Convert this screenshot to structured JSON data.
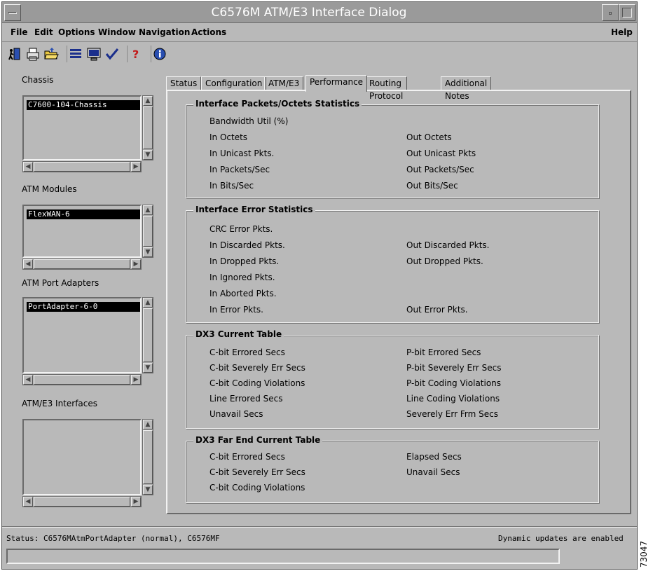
{
  "window": {
    "title": "C6576M ATM/E3 Interface Dialog"
  },
  "menubar": {
    "file": "File",
    "edit": "Edit",
    "options": "Options",
    "window": "Window",
    "navigation": "Navigation",
    "actions": "Actions",
    "help": "Help"
  },
  "toolbar": {
    "icons": [
      "exit-door-icon",
      "printer-icon",
      "open-folder-icon",
      "list-icon",
      "monitor-icon",
      "checkmark-icon",
      "help-question-icon",
      "info-icon"
    ]
  },
  "left": {
    "chassis": {
      "label": "Chassis",
      "items": [
        "C7600-104-Chassis"
      ]
    },
    "atm_modules": {
      "label": "ATM Modules",
      "items": [
        "FlexWAN-6"
      ]
    },
    "atm_port_adapters": {
      "label": "ATM Port Adapters",
      "items": [
        "PortAdapter-6-0"
      ]
    },
    "atm_e3_interfaces": {
      "label": "ATM/E3 Interfaces",
      "items": []
    }
  },
  "tabs": {
    "status": "Status",
    "configuration": "Configuration",
    "atm_e3": "ATM/E3",
    "performance": "Performance",
    "routing_protocol": "Routing Protocol",
    "additional_notes": "Additional Notes",
    "active": "Performance"
  },
  "groups": {
    "packets": {
      "title": "Interface Packets/Octets Statistics",
      "bandwidth": "Bandwidth Util (%)",
      "in_octets": "In Octets",
      "out_octets": "Out Octets",
      "in_unicast": "In Unicast Pkts.",
      "out_unicast": "Out Unicast Pkts",
      "in_pps": "In Packets/Sec",
      "out_pps": "Out Packets/Sec",
      "in_bps": "In Bits/Sec",
      "out_bps": "Out Bits/Sec"
    },
    "errors": {
      "title": "Interface Error Statistics",
      "crc": "CRC Error Pkts.",
      "in_discarded": "In Discarded Pkts.",
      "out_discarded": "Out Discarded Pkts.",
      "in_dropped": "In Dropped Pkts.",
      "out_dropped": "Out Dropped Pkts.",
      "in_ignored": "In Ignored Pkts.",
      "in_aborted": "In Aborted Pkts.",
      "in_error": "In Error Pkts.",
      "out_error": "Out Error Pkts."
    },
    "dx3": {
      "title": "DX3 Current Table",
      "c_errored": "C-bit Errored Secs",
      "p_errored": "P-bit Errored Secs",
      "c_severely": "C-bit Severely Err Secs",
      "p_severely": "P-bit Severely Err Secs",
      "c_coding": "C-bit Coding Violations",
      "p_coding": "P-bit Coding Violations",
      "line_errored": "Line Errored Secs",
      "line_coding": "Line Coding Violations",
      "unavail": "Unavail Secs",
      "severely_frm": "Severely Err Frm Secs"
    },
    "dx3_far": {
      "title": "DX3 Far End Current Table",
      "c_errored": "C-bit Errored Secs",
      "elapsed": "Elapsed Secs",
      "c_severely": "C-bit Severely Err Secs",
      "unavail": "Unavail Secs",
      "c_coding": "C-bit Coding Violations"
    }
  },
  "status": {
    "left": "Status: C6576MAtmPortAdapter (normal), C6576MF",
    "right": "Dynamic updates are enabled"
  },
  "figure_id": "73047"
}
